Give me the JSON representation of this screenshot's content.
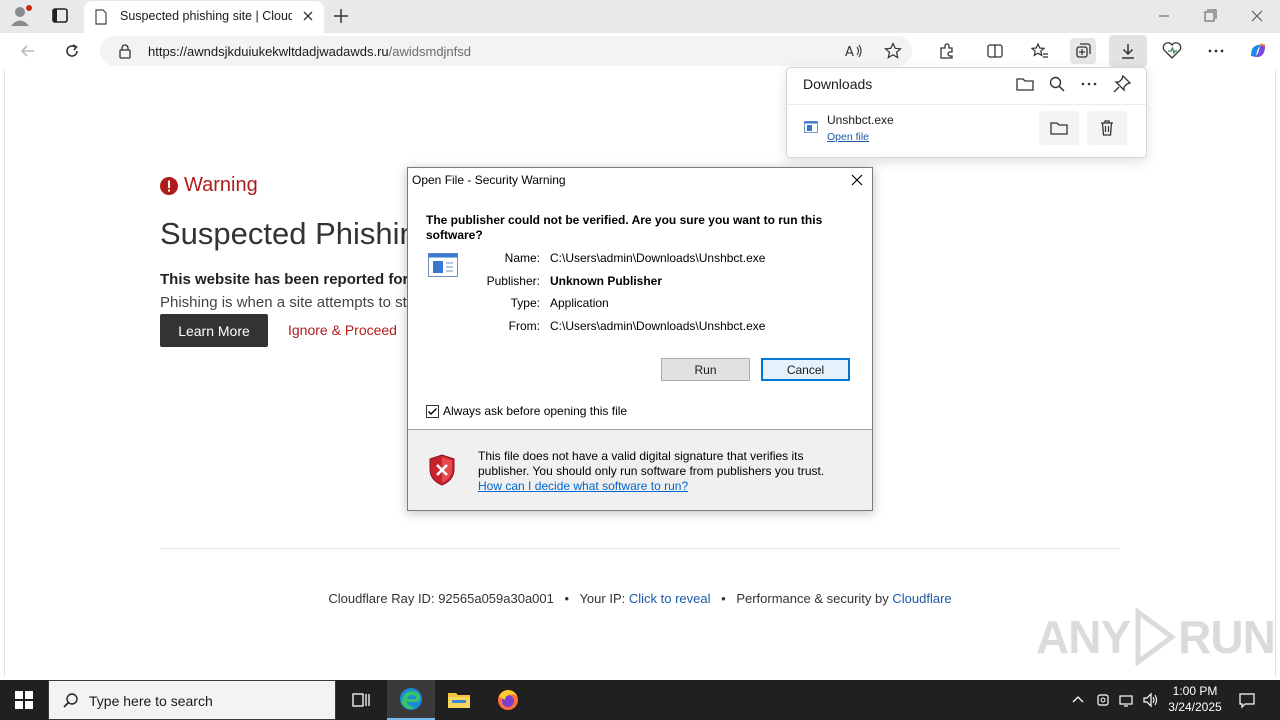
{
  "browser": {
    "tab_title": "Suspected phishing site | Cloudfl",
    "url_domain": "https://awndsjkduiukekwltdadjwadawds.ru",
    "url_path": "/awidsmdjnfsd"
  },
  "page": {
    "warning_label": "Warning",
    "heading": "Suspected Phishing",
    "reported_text": "This website has been reported for p",
    "explain_text": "Phishing is when a site attempts to ste",
    "learn_more": "Learn More",
    "ignore_proceed": "Ignore & Proceed",
    "footer": {
      "ray_label": "Cloudflare Ray ID:",
      "ray_id": "92565a059a30a001",
      "ip_label": "Your IP:",
      "ip_link": "Click to reveal",
      "perf_label": "Performance & security by",
      "perf_link": "Cloudflare",
      "bullet": "•"
    }
  },
  "downloads": {
    "title": "Downloads",
    "file_name": "Unshbct.exe",
    "open_file": "Open file"
  },
  "dialog": {
    "title": "Open File - Security Warning",
    "question": "The publisher could not be verified.  Are you sure you want to run this software?",
    "rows": [
      {
        "label": "Name:",
        "value": "C:\\Users\\admin\\Downloads\\Unshbct.exe"
      },
      {
        "label": "Publisher:",
        "value": "Unknown Publisher"
      },
      {
        "label": "Type:",
        "value": "Application"
      },
      {
        "label": "From:",
        "value": "C:\\Users\\admin\\Downloads\\Unshbct.exe"
      }
    ],
    "run": "Run",
    "cancel": "Cancel",
    "always_ask": "Always ask before opening this file",
    "always_ask_checked": true,
    "info": "This file does not have a valid digital signature that verifies its publisher.  You should only run software from publishers you trust.",
    "help_link": "How can I decide what software to run?"
  },
  "watermark": {
    "left": "ANY",
    "right": "RUN"
  },
  "taskbar": {
    "search_placeholder": "Type here to search",
    "time": "1:00 PM",
    "date": "3/24/2025"
  },
  "colors": {
    "warning_red": "#b01c1c",
    "link_blue": "#1a5aa6",
    "taskbar": "#202020"
  }
}
